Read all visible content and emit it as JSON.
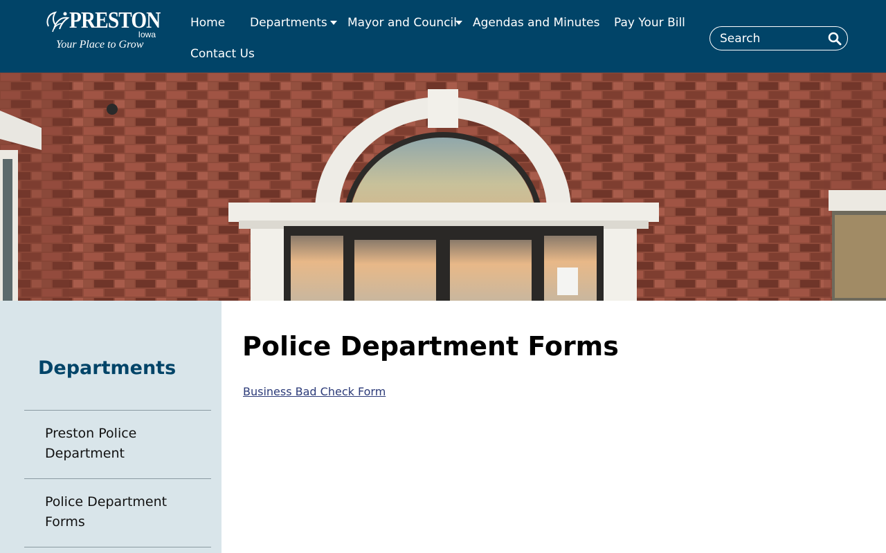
{
  "logo": {
    "name": "PRESTON",
    "state": "Iowa",
    "tagline": "Your Place to Grow"
  },
  "nav": {
    "home": "Home",
    "departments": "Departments",
    "mayor_council": "Mayor and Council",
    "agendas": "Agendas and Minutes",
    "pay_bill": "Pay Your Bill",
    "contact": "Contact Us"
  },
  "search": {
    "placeholder": "Search"
  },
  "sidebar": {
    "title": "Departments",
    "items": [
      {
        "label": "Preston Police Department"
      },
      {
        "label": "Police Department Forms"
      }
    ]
  },
  "main": {
    "title": "Police Department Forms",
    "links": [
      {
        "label": "Business Bad Check Form"
      }
    ]
  },
  "colors": {
    "header_bg": "#014468",
    "sidebar_bg": "#d9e5ea",
    "sidebar_title": "#014468",
    "link": "#2b3a78"
  },
  "icons": {
    "search": "search-icon",
    "caret": "chevron-down-icon",
    "logo": "leaf-logo-icon"
  }
}
